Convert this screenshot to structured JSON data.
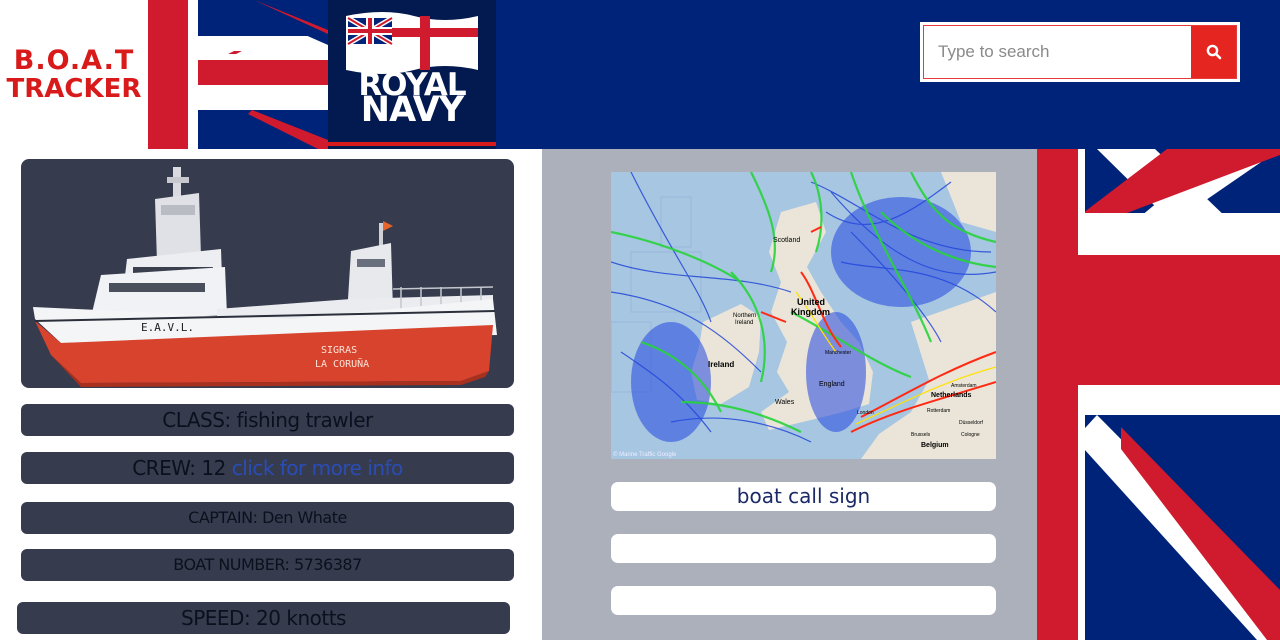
{
  "header": {
    "logo_line1": "B.O.A.T",
    "logo_line2": "TRACKER",
    "navy_line1": "ROYAL",
    "navy_line2": "NAVY",
    "search_placeholder": "Type to search",
    "search_icon": "search-icon"
  },
  "boat": {
    "hull_name": "SIGRAS",
    "hull_port": "LA CORUÑA",
    "bow_text": "E.A.V.L.",
    "class_label": "CLASS: fishing trawler",
    "crew_label": "CREW: 12",
    "crew_link": "click for more info",
    "captain_label": "CAPTAIN: Den Whate",
    "number_label": "BOAT NUMBER: 5736387",
    "speed_label": "SPEED: 20 knotts"
  },
  "map": {
    "labels": {
      "scotland": "Scotland",
      "uk1": "United",
      "uk2": "Kingdom",
      "northern_ireland1": "Northern",
      "northern_ireland2": "Ireland",
      "ireland": "Ireland",
      "england": "England",
      "wales": "Wales",
      "netherlands": "Netherlands",
      "belgium": "Belgium",
      "manchester": "Manchester",
      "london": "London",
      "amsterdam": "Amsterdam",
      "rotterdam": "Rotterdam",
      "dusseldorf": "Düsseldorf",
      "cologne": "Cologne",
      "brussels": "Brussels"
    },
    "credit": "© Marine Traffic Google"
  },
  "fields": {
    "call_sign": "boat call sign",
    "field_2": "",
    "field_3": ""
  },
  "colors": {
    "navy_blue": "#00237a",
    "flag_red": "#d01a2e",
    "panel_dark": "#363b4e",
    "panel_grey": "#acb0bb",
    "search_red": "#e52620"
  }
}
